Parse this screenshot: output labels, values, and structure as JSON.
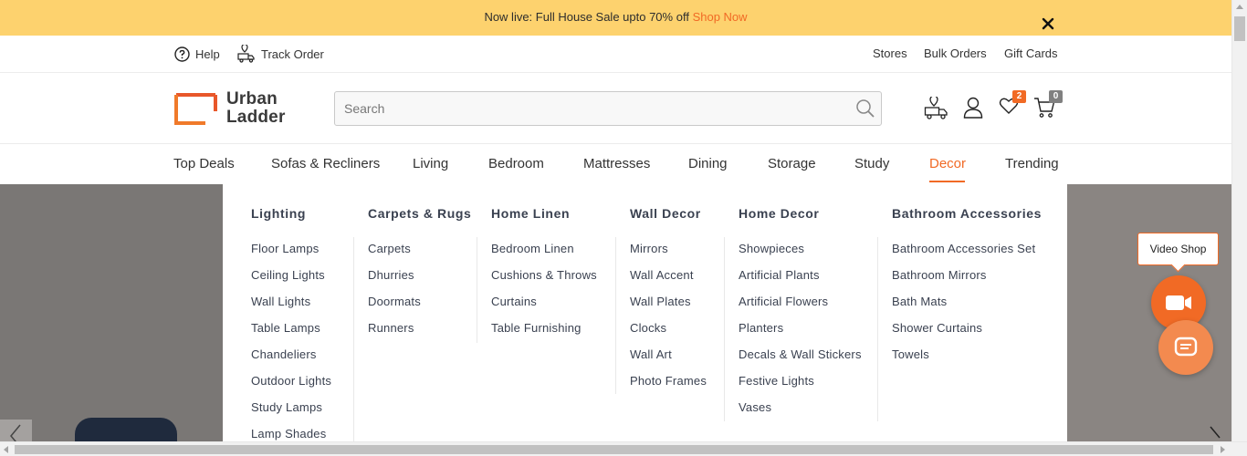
{
  "announcement": {
    "text": "Now live: Full House Sale upto 70% off",
    "cta": "Shop Now"
  },
  "utility": {
    "help": "Help",
    "track_order": "Track Order",
    "stores": "Stores",
    "bulk_orders": "Bulk Orders",
    "gift_cards": "Gift Cards"
  },
  "logo": {
    "line1": "Urban",
    "line2": "Ladder"
  },
  "search": {
    "placeholder": "Search"
  },
  "header_icons": {
    "wishlist_count": "2",
    "cart_count": "0"
  },
  "nav": {
    "items": [
      "Top Deals",
      "Sofas & Recliners",
      "Living",
      "Bedroom",
      "Mattresses",
      "Dining",
      "Storage",
      "Study",
      "Decor",
      "Trending"
    ],
    "active": "Decor"
  },
  "mega_menu": {
    "columns": [
      {
        "title": "Lighting",
        "items": [
          "Floor Lamps",
          "Ceiling Lights",
          "Wall Lights",
          "Table Lamps",
          "Chandeliers",
          "Outdoor Lights",
          "Study Lamps",
          "Lamp Shades"
        ]
      },
      {
        "title": "Carpets & Rugs",
        "items": [
          "Carpets",
          "Dhurries",
          "Doormats",
          "Runners"
        ]
      },
      {
        "title": "Home Linen",
        "items": [
          "Bedroom Linen",
          "Cushions & Throws",
          "Curtains",
          "Table Furnishing"
        ]
      },
      {
        "title": "Wall Decor",
        "items": [
          "Mirrors",
          "Wall Accent",
          "Wall Plates",
          "Clocks",
          "Wall Art",
          "Photo Frames"
        ]
      },
      {
        "title": "Home Decor",
        "items": [
          "Showpieces",
          "Artificial Plants",
          "Artificial Flowers",
          "Planters",
          "Decals & Wall Stickers",
          "Festive Lights",
          "Vases"
        ]
      },
      {
        "title": "Bathroom Accessories",
        "items": [
          "Bathroom Accessories Set",
          "Bathroom Mirrors",
          "Bath Mats",
          "Shower Curtains",
          "Towels"
        ]
      }
    ]
  },
  "video_shop": {
    "label": "Video Shop"
  },
  "colors": {
    "accent": "#f16a25",
    "banner": "#fdd26e",
    "text": "#333333"
  }
}
